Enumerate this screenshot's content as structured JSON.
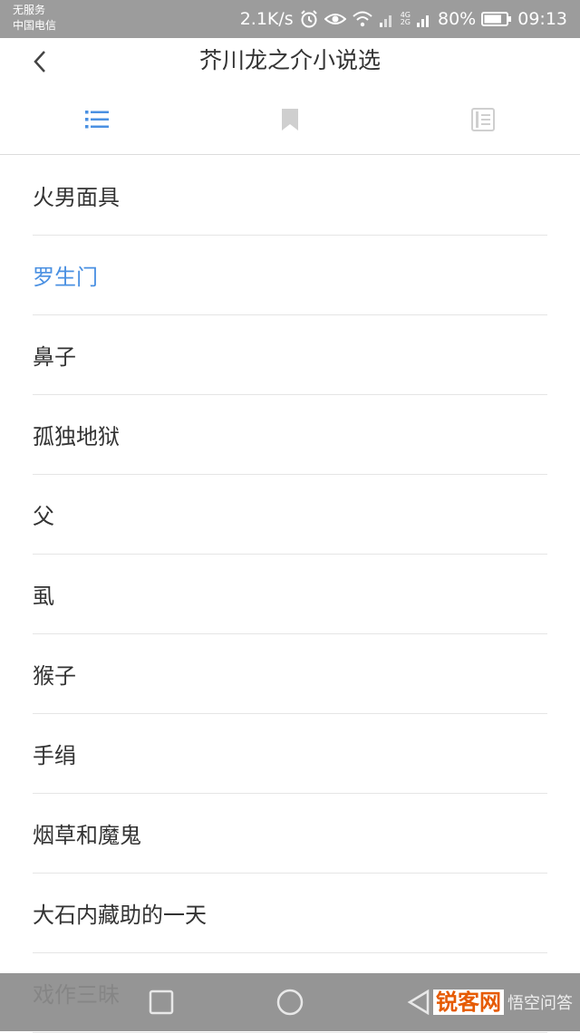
{
  "status_bar": {
    "no_service": "无服务",
    "carrier": "中国电信",
    "speed": "2.1K/s",
    "network_tag_top": "4G",
    "network_tag_bottom": "2G",
    "battery": "80%",
    "time": "09:13"
  },
  "header": {
    "title": "芥川龙之介小说选"
  },
  "tabs": [
    {
      "id": "contents",
      "icon": "list-icon",
      "active": true
    },
    {
      "id": "bookmarks",
      "icon": "bookmark-icon",
      "active": false
    },
    {
      "id": "notes",
      "icon": "notes-icon",
      "active": false
    }
  ],
  "chapters": [
    {
      "title": "火男面具",
      "active": false
    },
    {
      "title": "罗生门",
      "active": true
    },
    {
      "title": "鼻子",
      "active": false
    },
    {
      "title": "孤独地狱",
      "active": false
    },
    {
      "title": "父",
      "active": false
    },
    {
      "title": "虱",
      "active": false
    },
    {
      "title": "猴子",
      "active": false
    },
    {
      "title": "手绢",
      "active": false
    },
    {
      "title": "烟草和魔鬼",
      "active": false
    },
    {
      "title": "大石内藏助的一天",
      "active": false
    },
    {
      "title": "戏作三昧",
      "active": false
    }
  ],
  "watermark": {
    "brand": "锐客网",
    "text": "悟空问答"
  },
  "colors": {
    "accent": "#4a90e2",
    "status_bar": "#9c9c9c",
    "text": "#333333",
    "divider": "#e5e5e5"
  }
}
